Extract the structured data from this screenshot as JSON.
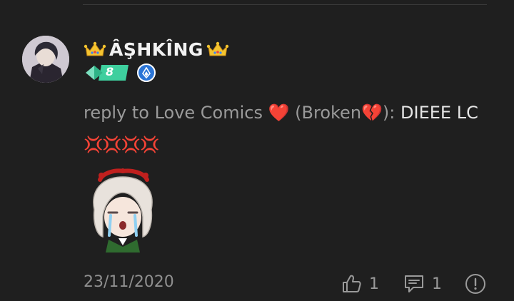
{
  "post": {
    "author": {
      "name": "ÂŞHKÎNG",
      "level": "8"
    },
    "comment": {
      "reply_prefix": "reply to Love Comics",
      "heart_emoji": "❤️",
      "broken_label": "(Broken",
      "broken_emoji": "💔",
      "separator": "):",
      "text": "DIEEE LC",
      "anger_emojis": "💢💢💢💢"
    },
    "date": "23/11/2020",
    "like_count": "1",
    "reply_count": "1"
  },
  "icons": {
    "crown": "crown-icon",
    "level": "level-badge-icon",
    "verify": "verified-icon",
    "like": "thumbs-up-icon",
    "reply": "comment-icon",
    "report": "report-icon"
  },
  "colors": {
    "background": "#1f1f1f",
    "username": "#f2f2f2",
    "muted": "#9a9a9a",
    "heart": "#e0262a",
    "level_badge": "#3ecf9e",
    "verify_badge": "#2b75d6"
  }
}
